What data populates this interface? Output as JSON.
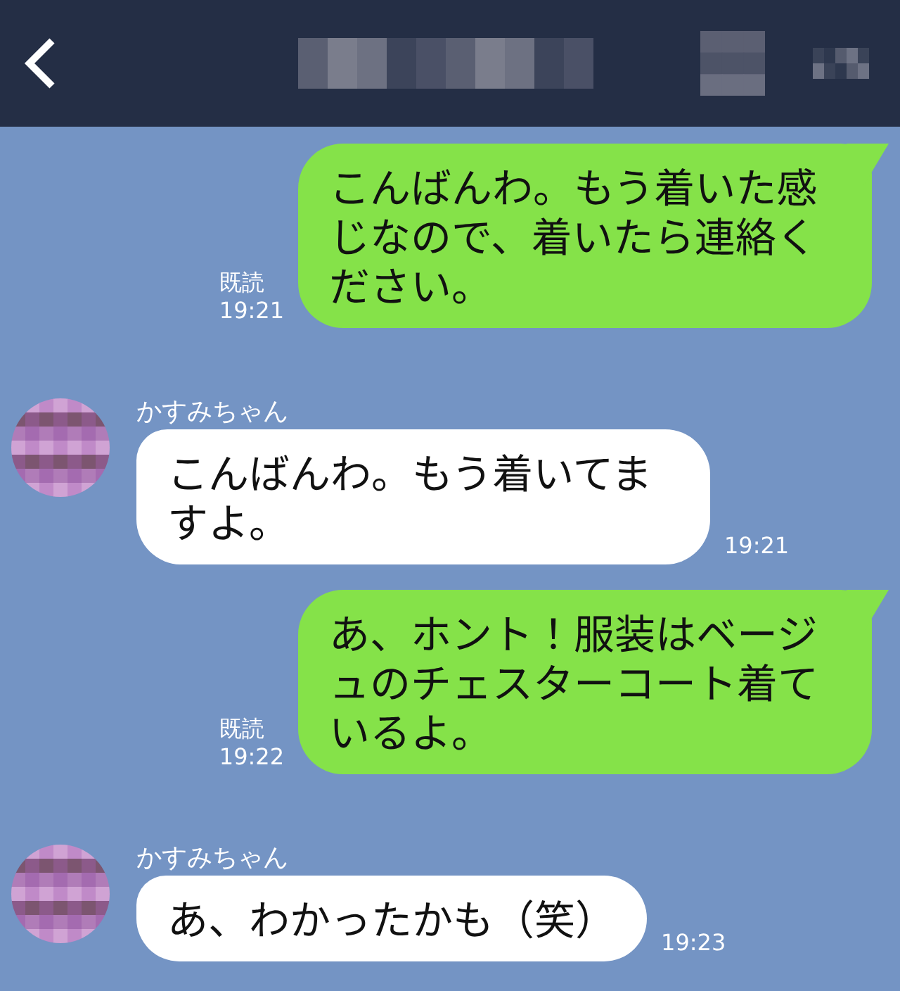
{
  "messages": [
    {
      "kind": "outgoing",
      "text": "こんばんわ。もう着いた感じなので、着いたら連絡ください。",
      "read": "既読",
      "time": "19:21"
    },
    {
      "kind": "incoming",
      "sender": "かすみちゃん",
      "text": "こんばんわ。もう着いてますよ。",
      "time": "19:21"
    },
    {
      "kind": "outgoing",
      "text": "あ、ホント！服装はベージュのチェスターコート着ているよ。",
      "read": "既読",
      "time": "19:22"
    },
    {
      "kind": "incoming",
      "sender": "かすみちゃん",
      "text": "あ、わかったかも（笑）",
      "time": "19:23"
    }
  ]
}
